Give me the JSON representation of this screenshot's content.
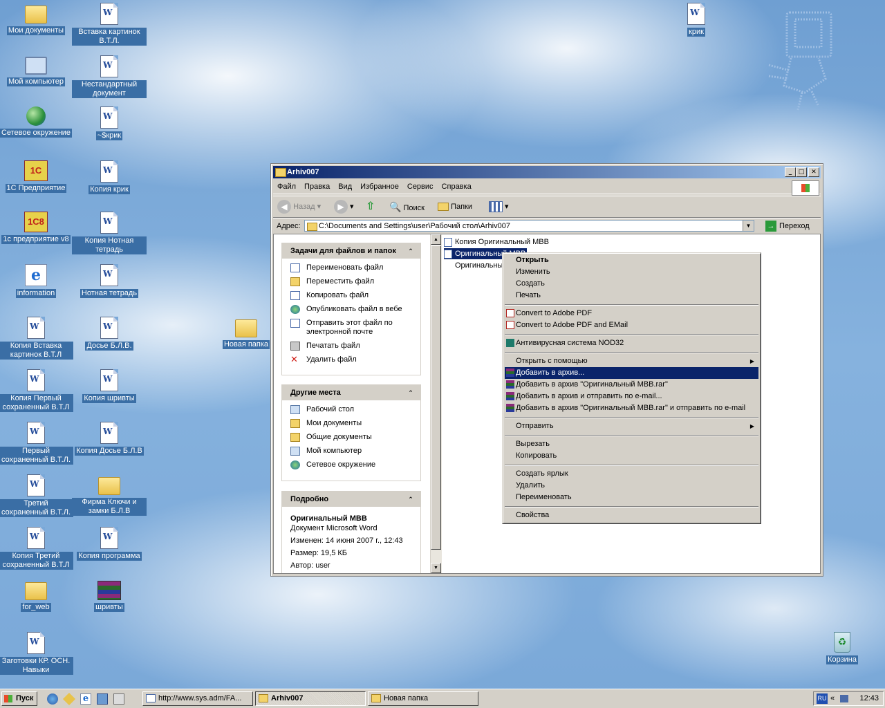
{
  "desktop": {
    "icons": [
      {
        "label": "Мои документы"
      },
      {
        "label": "Мой компьютер"
      },
      {
        "label": "Сетевое окружение"
      },
      {
        "label": "1С Предприятие"
      },
      {
        "label": "1с предприятие v8"
      },
      {
        "label": "information"
      },
      {
        "label": "Копия Вставка картинок В.Т.Л"
      },
      {
        "label": "Копия Первый сохраненный В.Т.Л"
      },
      {
        "label": "Первый сохраненный В.Т.Л."
      },
      {
        "label": "Третий сохраненный В.Т.Л."
      },
      {
        "label": "Копия Третий сохраненный В.Т.Л"
      },
      {
        "label": "for_web"
      },
      {
        "label": "Заготовки КР. ОСН. Навыки"
      },
      {
        "label": "Вставка картинок В.Т.Л."
      },
      {
        "label": "Нестандартный документ"
      },
      {
        "label": "~$крик"
      },
      {
        "label": "Копия крик"
      },
      {
        "label": "Копия Нотная тетрадь"
      },
      {
        "label": "Нотная тетрадь"
      },
      {
        "label": "Досье Б.Л.В."
      },
      {
        "label": "Копия шривты"
      },
      {
        "label": "Копия Досье Б.Л.В"
      },
      {
        "label": "Фирма Ключи и замки Б.Л.В"
      },
      {
        "label": "Копия программа"
      },
      {
        "label": "шривты"
      },
      {
        "label": "Новая папка"
      },
      {
        "label": "крик"
      },
      {
        "label": "Корзина"
      }
    ]
  },
  "window": {
    "title": "Arhiv007",
    "menu": [
      "Файл",
      "Правка",
      "Вид",
      "Избранное",
      "Сервис",
      "Справка"
    ],
    "toolbar": {
      "back": "Назад",
      "search": "Поиск",
      "folders": "Папки"
    },
    "address": {
      "label": "Адрес:",
      "value": "C:\\Documents and Settings\\user\\Рабочий стол\\Arhiv007",
      "go": "Переход"
    },
    "tasks": {
      "title": "Задачи для файлов и папок",
      "items": [
        "Переименовать файл",
        "Переместить файл",
        "Копировать файл",
        "Опубликовать файл в вебе",
        "Отправить этот файл по электронной почте",
        "Печатать файл",
        "Удалить файл"
      ]
    },
    "places": {
      "title": "Другие места",
      "items": [
        "Рабочий стол",
        "Мои документы",
        "Общие документы",
        "Мой компьютер",
        "Сетевое окружение"
      ]
    },
    "details": {
      "title": "Подробно",
      "name": "Оригинальный МВВ",
      "type": "Документ Microsoft Word",
      "modified": "Изменен: 14 июня 2007 г., 12:43",
      "size": "Размер: 19,5 КБ",
      "author": "Автор: user"
    },
    "files": [
      "Копия Оригинальный МВВ",
      "Оригинальный МВВ",
      "Оригинальный"
    ]
  },
  "context_menu": {
    "items": [
      "Открыть",
      "Изменить",
      "Создать",
      "Печать",
      "Convert to Adobe PDF",
      "Convert to Adobe PDF and EMail",
      "Антивирусная система NOD32",
      "Открыть с помощью",
      "Добавить в архив...",
      "Добавить в архив \"Оригинальный МВВ.rar\"",
      "Добавить в архив и отправить по e-mail...",
      "Добавить в архив \"Оригинальный МВВ.rar\" и отправить по e-mail",
      "Отправить",
      "Вырезать",
      "Копировать",
      "Создать ярлык",
      "Удалить",
      "Переименовать",
      "Свойства"
    ]
  },
  "taskbar": {
    "start": "Пуск",
    "tasks": [
      "http://www.sys.adm/FA...",
      "Arhiv007",
      "Новая папка"
    ],
    "lang": "RU",
    "clock": "12:43"
  }
}
